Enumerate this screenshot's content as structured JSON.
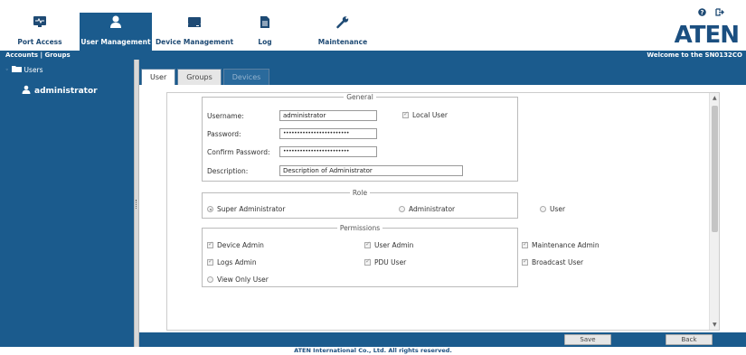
{
  "nav": {
    "tabs": [
      {
        "label": "Port Access",
        "icon": "port-access-icon"
      },
      {
        "label": "User Management",
        "icon": "user-icon"
      },
      {
        "label": "Device Management",
        "icon": "device-icon"
      },
      {
        "label": "Log",
        "icon": "log-icon"
      },
      {
        "label": "Maintenance",
        "icon": "wrench-icon"
      }
    ],
    "active": "User Management",
    "brand": "ATEN"
  },
  "subbar": {
    "accounts": "Accounts",
    "separator": "|",
    "groups": "Groups",
    "welcome": "Welcome to the SN0132CO"
  },
  "sidebar": {
    "root": "Users",
    "items": [
      {
        "label": "administrator"
      }
    ]
  },
  "tabs": [
    {
      "label": "User"
    },
    {
      "label": "Groups"
    },
    {
      "label": "Devices"
    }
  ],
  "general": {
    "legend": "General",
    "username_label": "Username:",
    "username_value": "administrator",
    "local_user_label": "Local User",
    "password_label": "Password:",
    "password_value": "••••••••••••••••••••••••",
    "confirm_label": "Confirm Password:",
    "confirm_value": "••••••••••••••••••••••••",
    "description_label": "Description:",
    "description_value": "Description of Administrator"
  },
  "role": {
    "legend": "Role",
    "options": [
      "Super Administrator",
      "Administrator",
      "User"
    ],
    "selected": "Super Administrator"
  },
  "permissions": {
    "legend": "Permissions",
    "items": [
      {
        "label": "Device Admin",
        "checked": true
      },
      {
        "label": "User Admin",
        "checked": true
      },
      {
        "label": "Maintenance Admin",
        "checked": true
      },
      {
        "label": "Logs Admin",
        "checked": true
      },
      {
        "label": "PDU User",
        "checked": true
      },
      {
        "label": "Broadcast User",
        "checked": true
      },
      {
        "label": "View Only User",
        "checked": false
      }
    ]
  },
  "buttons": {
    "save": "Save",
    "back": "Back"
  },
  "footer": "ATEN International Co., Ltd. All rights reserved.",
  "colors": {
    "primary": "#1b5b8d",
    "brand": "#1b4f80"
  }
}
